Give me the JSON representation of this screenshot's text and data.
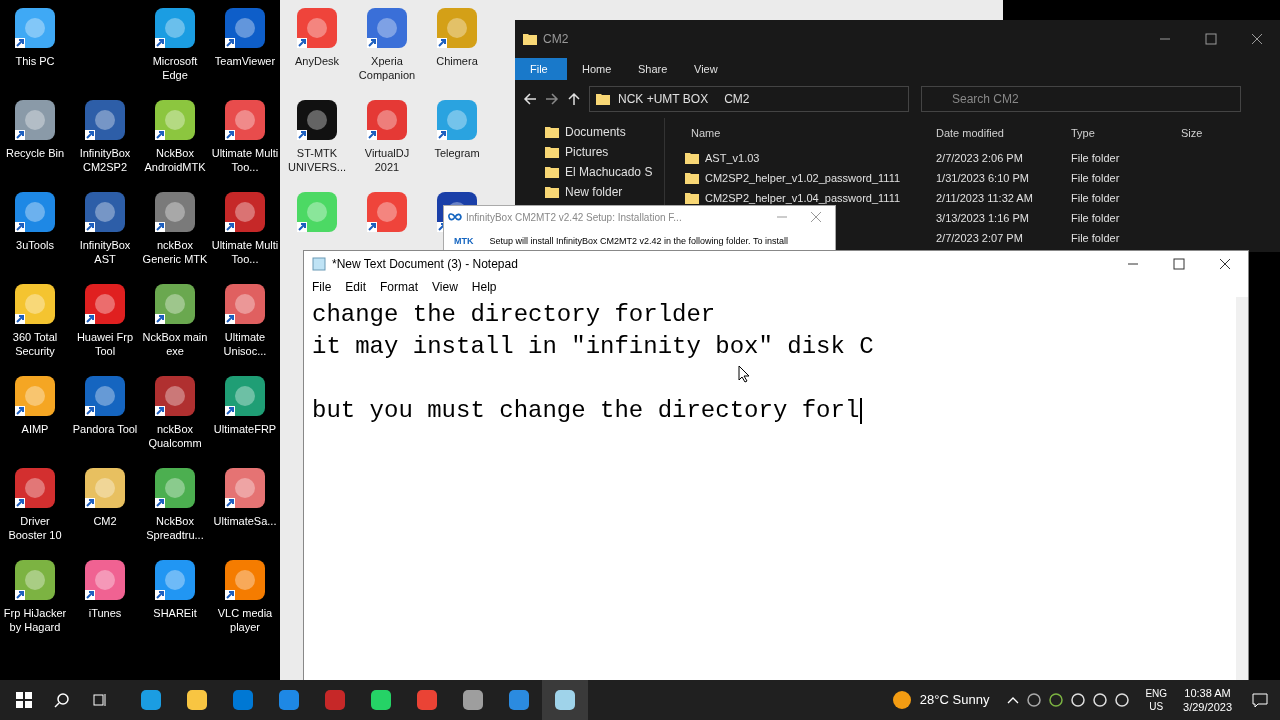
{
  "desktop_icons": [
    {
      "label": "This PC",
      "color": "#3fa9f5"
    },
    {
      "kind": "empty"
    },
    {
      "label": "Microsoft Edge",
      "color": "#1b9de2"
    },
    {
      "label": "TeamViewer",
      "color": "#0e5ec9"
    },
    {
      "label": "Recycle Bin",
      "color": "#8a9aa8"
    },
    {
      "label": "InfinityBox CM2SP2",
      "color": "#2d5ea8"
    },
    {
      "label": "NckBox AndroidMTK",
      "color": "#8cc63f"
    },
    {
      "label": "Ultimate Multi Too...",
      "color": "#e84c4c"
    },
    {
      "label": "3uTools",
      "color": "#1e88e5"
    },
    {
      "label": "InfinityBox AST",
      "color": "#2d5ea8"
    },
    {
      "label": "nckBox Generic MTK",
      "color": "#7a7a7a"
    },
    {
      "label": "Ultimate Multi Too...",
      "color": "#c62828"
    },
    {
      "label": "360 Total Security",
      "color": "#f4c430"
    },
    {
      "label": "Huawei Frp Tool",
      "color": "#e02020"
    },
    {
      "label": "NckBox main exe",
      "color": "#6aa84f"
    },
    {
      "label": "Ultimate Unisoc...",
      "color": "#e06060"
    },
    {
      "label": "AIMP",
      "color": "#f5a623"
    },
    {
      "label": "Pandora Tool",
      "color": "#1565c0"
    },
    {
      "label": "nckBox Qualcomm",
      "color": "#b03030"
    },
    {
      "label": "UltimateFRP",
      "color": "#1f9e75"
    },
    {
      "label": "Driver Booster 10",
      "color": "#d32f2f"
    },
    {
      "label": "CM2",
      "color": "#e8c060"
    },
    {
      "label": "NckBox Spreadtru...",
      "color": "#4caf50"
    },
    {
      "label": "UltimateSa...",
      "color": "#e57373"
    },
    {
      "label": "Frp HiJacker by Hagard",
      "color": "#7cb342"
    },
    {
      "label": "iTunes",
      "color": "#f06292"
    },
    {
      "label": "SHAREit",
      "color": "#2196f3"
    },
    {
      "label": "VLC media player",
      "color": "#f57c00"
    }
  ],
  "desktop_icons_2": [
    {
      "label": "AnyDesk",
      "color": "#ef443b"
    },
    {
      "label": "Xperia Companion",
      "color": "#3a6fd8"
    },
    {
      "label": "Chimera",
      "color": "#d4a017"
    },
    {
      "label": "ST-MTK UNIVERS...",
      "color": "#111111"
    },
    {
      "label": "VirtualDJ 2021",
      "color": "#e53935"
    },
    {
      "label": "Telegram",
      "color": "#2aa3e0"
    },
    {
      "color": "#4cd964"
    },
    {
      "color": "#ef443b"
    },
    {
      "color": "#1a3fa8"
    }
  ],
  "explorer": {
    "title": "CM2",
    "ribbon_tabs": [
      {
        "label": "File",
        "selected": true
      },
      {
        "label": "Home",
        "selected": false
      },
      {
        "label": "Share",
        "selected": false
      },
      {
        "label": "View",
        "selected": false
      }
    ],
    "breadcrumb": [
      "NCK +UMT BOX",
      "CM2"
    ],
    "search": {
      "placeholder": "Search CM2"
    },
    "nav_items": [
      "Documents",
      "Pictures",
      "El Machucado S",
      "New folder"
    ],
    "columns": [
      "Name",
      "Date modified",
      "Type",
      "Size"
    ],
    "rows": [
      {
        "name": "AST_v1.03",
        "date": "2/7/2023 2:06 PM",
        "type": "File folder"
      },
      {
        "name": "CM2SP2_helper_v1.02_password_1111",
        "date": "1/31/2023 6:10 PM",
        "type": "File folder"
      },
      {
        "name": "CM2SP2_helper_v1.04_password_1111",
        "date": "2/11/2023 11:32 AM",
        "type": "File folder"
      },
      {
        "date": "3/13/2023 1:16 PM",
        "type": "File folder"
      },
      {
        "date": "2/7/2023 2:07 PM",
        "type": "File folder"
      }
    ]
  },
  "setup_dialog": {
    "title": "InfinityBox CM2MT2 v2.42 Setup: Installation F...",
    "logo": "MTK",
    "text": "Setup will install InfinityBox CM2MT2 v2.42 in the following folder. To install"
  },
  "notepad": {
    "title": "*New Text Document (3) - Notepad",
    "menu": [
      "File",
      "Edit",
      "Format",
      "View",
      "Help"
    ],
    "lines": [
      {
        "text": "change the directory forlder"
      },
      {
        "text": "it may install in \"infinity box\" disk C"
      },
      {
        "text": "but you must change the directory forl",
        "blank_before": true
      }
    ]
  },
  "taskbar": {
    "weather": "28°C Sunny",
    "language": "ENG",
    "region": "US",
    "time": "10:38 AM",
    "date": "3/29/2023"
  }
}
